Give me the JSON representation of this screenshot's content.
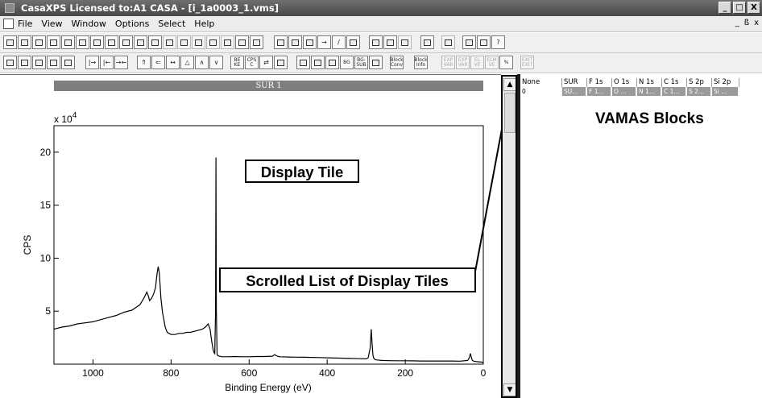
{
  "window": {
    "title": "CasaXPS Licensed to:A1 CASA - [i_1a0003_1.vms]",
    "controls": [
      "_",
      "□",
      "X"
    ]
  },
  "menu": {
    "items": [
      "File",
      "View",
      "Window",
      "Options",
      "Select",
      "Help"
    ],
    "mdi_controls": [
      "_",
      "ß",
      "x"
    ]
  },
  "toolbar2": {
    "labels": [
      "BE KE",
      "CPS C",
      "BG",
      "BG- SUB",
      "Block Conv",
      "Block Info",
      "EXP VAR",
      "EXP VAR",
      "EL VE",
      "ELM VE",
      "%",
      "EXIT EXIT"
    ]
  },
  "display": {
    "tile_title": "SUR 1",
    "scroll_up": "▲",
    "scroll_down": "▼"
  },
  "chart_data": {
    "type": "line",
    "title": "",
    "xlabel": "Binding Energy (eV)",
    "ylabel": "CPS",
    "y_multiplier": "x 10",
    "y_multiplier_exp": "4",
    "x_reversed": true,
    "xlim": [
      1100,
      0
    ],
    "ylim": [
      0,
      22.5
    ],
    "x_ticks": [
      1000,
      800,
      600,
      400,
      200,
      0
    ],
    "x_tick_labels": [
      "1000",
      "800",
      "600",
      "400",
      "200",
      "0"
    ],
    "y_ticks": [
      5,
      10,
      15,
      20
    ],
    "y_tick_labels": [
      "5",
      "10",
      "15",
      "20"
    ],
    "grid": false,
    "series": [
      {
        "x": [
          1100,
          1080,
          1060,
          1040,
          1020,
          1000,
          980,
          960,
          940,
          920,
          900,
          880,
          875,
          870,
          866,
          862,
          858,
          855,
          850,
          845,
          840,
          836,
          833,
          830,
          826,
          822,
          815,
          810,
          805,
          800,
          790,
          780,
          770,
          760,
          750,
          740,
          730,
          720,
          712,
          705,
          700,
          696,
          692,
          690,
          688,
          686,
          685,
          684,
          682,
          680,
          676,
          670,
          660,
          650,
          640,
          620,
          600,
          580,
          560,
          540,
          535,
          530,
          525,
          520,
          500,
          480,
          460,
          440,
          420,
          400,
          380,
          360,
          340,
          320,
          300,
          295,
          290,
          287,
          285,
          283,
          281,
          278,
          275,
          260,
          240,
          220,
          200,
          180,
          160,
          140,
          120,
          100,
          80,
          60,
          40,
          36,
          33,
          31,
          28,
          24,
          20,
          12,
          5,
          0
        ],
        "y": [
          3.3,
          3.5,
          3.6,
          3.8,
          3.9,
          4.0,
          4.2,
          4.4,
          4.6,
          4.9,
          5.1,
          5.6,
          5.9,
          6.2,
          6.5,
          6.8,
          6.4,
          6.0,
          6.2,
          6.6,
          7.2,
          8.5,
          9.2,
          8.6,
          6.2,
          4.9,
          3.5,
          3.0,
          2.9,
          2.8,
          2.8,
          2.9,
          2.9,
          3.0,
          3.0,
          3.1,
          3.2,
          3.3,
          3.5,
          3.8,
          3.3,
          2.2,
          1.3,
          1.1,
          1.0,
          5.0,
          19.5,
          5.0,
          0.9,
          0.8,
          0.75,
          0.7,
          0.7,
          0.7,
          0.72,
          0.7,
          0.7,
          0.72,
          0.72,
          0.75,
          0.9,
          0.8,
          0.72,
          0.7,
          0.68,
          0.66,
          0.65,
          0.64,
          0.62,
          0.6,
          0.58,
          0.56,
          0.54,
          0.52,
          0.5,
          0.6,
          1.5,
          3.3,
          2.0,
          0.9,
          0.6,
          0.45,
          0.4,
          0.35,
          0.33,
          0.32,
          0.32,
          0.31,
          0.3,
          0.3,
          0.3,
          0.3,
          0.3,
          0.28,
          0.35,
          0.6,
          1.0,
          0.7,
          0.35,
          0.28,
          0.25,
          0.22,
          0.2,
          0.15
        ]
      }
    ]
  },
  "annotations": {
    "display_tile": "Display Tile",
    "scrolled_list": "Scrolled List of Display Tiles",
    "vamas_blocks": "VAMAS Blocks"
  },
  "blocks": {
    "headers": [
      "None",
      "SUR",
      "F 1s",
      "O 1s",
      "N 1s",
      "C 1s",
      "S 2p",
      "Si 2p"
    ],
    "row": [
      "0",
      "SU...",
      "F 1...",
      "O ...",
      "N 1...",
      "C 1...",
      "S 2...",
      "Si ..."
    ]
  }
}
